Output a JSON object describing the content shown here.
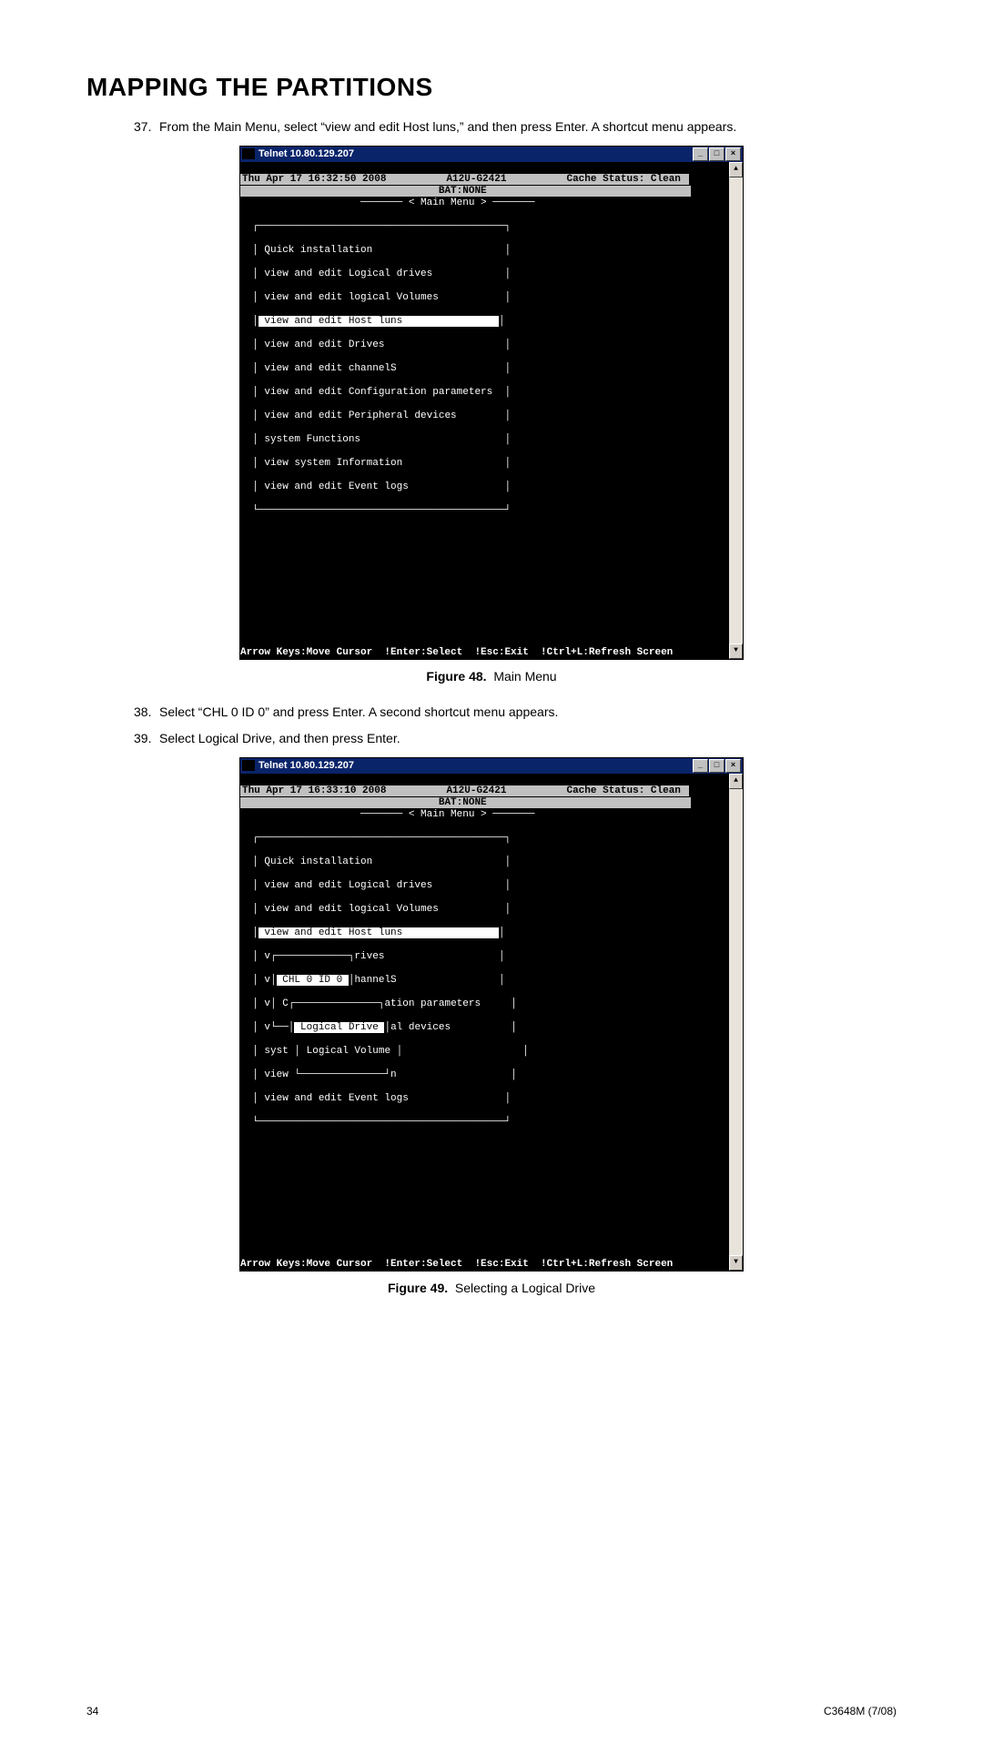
{
  "heading": "MAPPING THE PARTITIONS",
  "steps": {
    "s37": {
      "num": "37.",
      "text": "From the Main Menu, select “view and edit Host luns,” and then press Enter. A shortcut menu appears."
    },
    "s38": {
      "num": "38.",
      "text": "Select “CHL 0 ID 0” and press Enter. A second shortcut menu appears."
    },
    "s39": {
      "num": "39.",
      "text": "Select Logical Drive, and then press Enter."
    }
  },
  "figure48": {
    "label": "Figure 48.",
    "caption": "Main Menu"
  },
  "figure49": {
    "label": "Figure 49.",
    "caption": "Selecting a Logical Drive"
  },
  "term1": {
    "title": "Telnet 10.80.129.207",
    "status_left": "Thu Apr 17 16:32:50 2008",
    "status_mid": "A12U-G2421",
    "status_right": "Cache Status: Clean",
    "bat": "BAT:NONE",
    "menu_title": "< Main Menu >",
    "items": [
      "Quick installation",
      "view and edit Logical drives",
      "view and edit logical Volumes",
      "view and edit Host luns",
      "view and edit Drives",
      "view and edit channelS",
      "view and edit Configuration parameters",
      "view and edit Peripheral devices",
      "system Functions",
      "view system Information",
      "view and edit Event logs"
    ],
    "footer": "Arrow Keys:Move Cursor  !Enter:Select  !Esc:Exit  !Ctrl+L:Refresh Screen"
  },
  "term2": {
    "title": "Telnet 10.80.129.207",
    "status_left": "Thu Apr 17 16:33:10 2008",
    "status_mid": "A12U-G2421",
    "status_right": "Cache Status: Clean",
    "bat": "BAT:NONE",
    "menu_title": "< Main Menu >",
    "items_top": [
      "Quick installation",
      "view and edit Logical drives",
      "view and edit logical Volumes",
      "view and edit Host luns"
    ],
    "sub_chl": "CHL 0 ID 0",
    "frag_hannels": "hannelS",
    "frag_rives": "rives",
    "frag_c": "C",
    "frag_params": "ation parameters",
    "frag_aldev": "al devices",
    "sub_ld": "Logical Drive",
    "sub_lv": "Logical Volume",
    "frag_syst": "syst",
    "frag_view": "view",
    "frag_n": "n",
    "last_item": "view and edit Event logs",
    "footer": "Arrow Keys:Move Cursor  !Enter:Select  !Esc:Exit  !Ctrl+L:Refresh Screen"
  },
  "footer": {
    "page": "34",
    "doc": "C3648M (7/08)"
  }
}
